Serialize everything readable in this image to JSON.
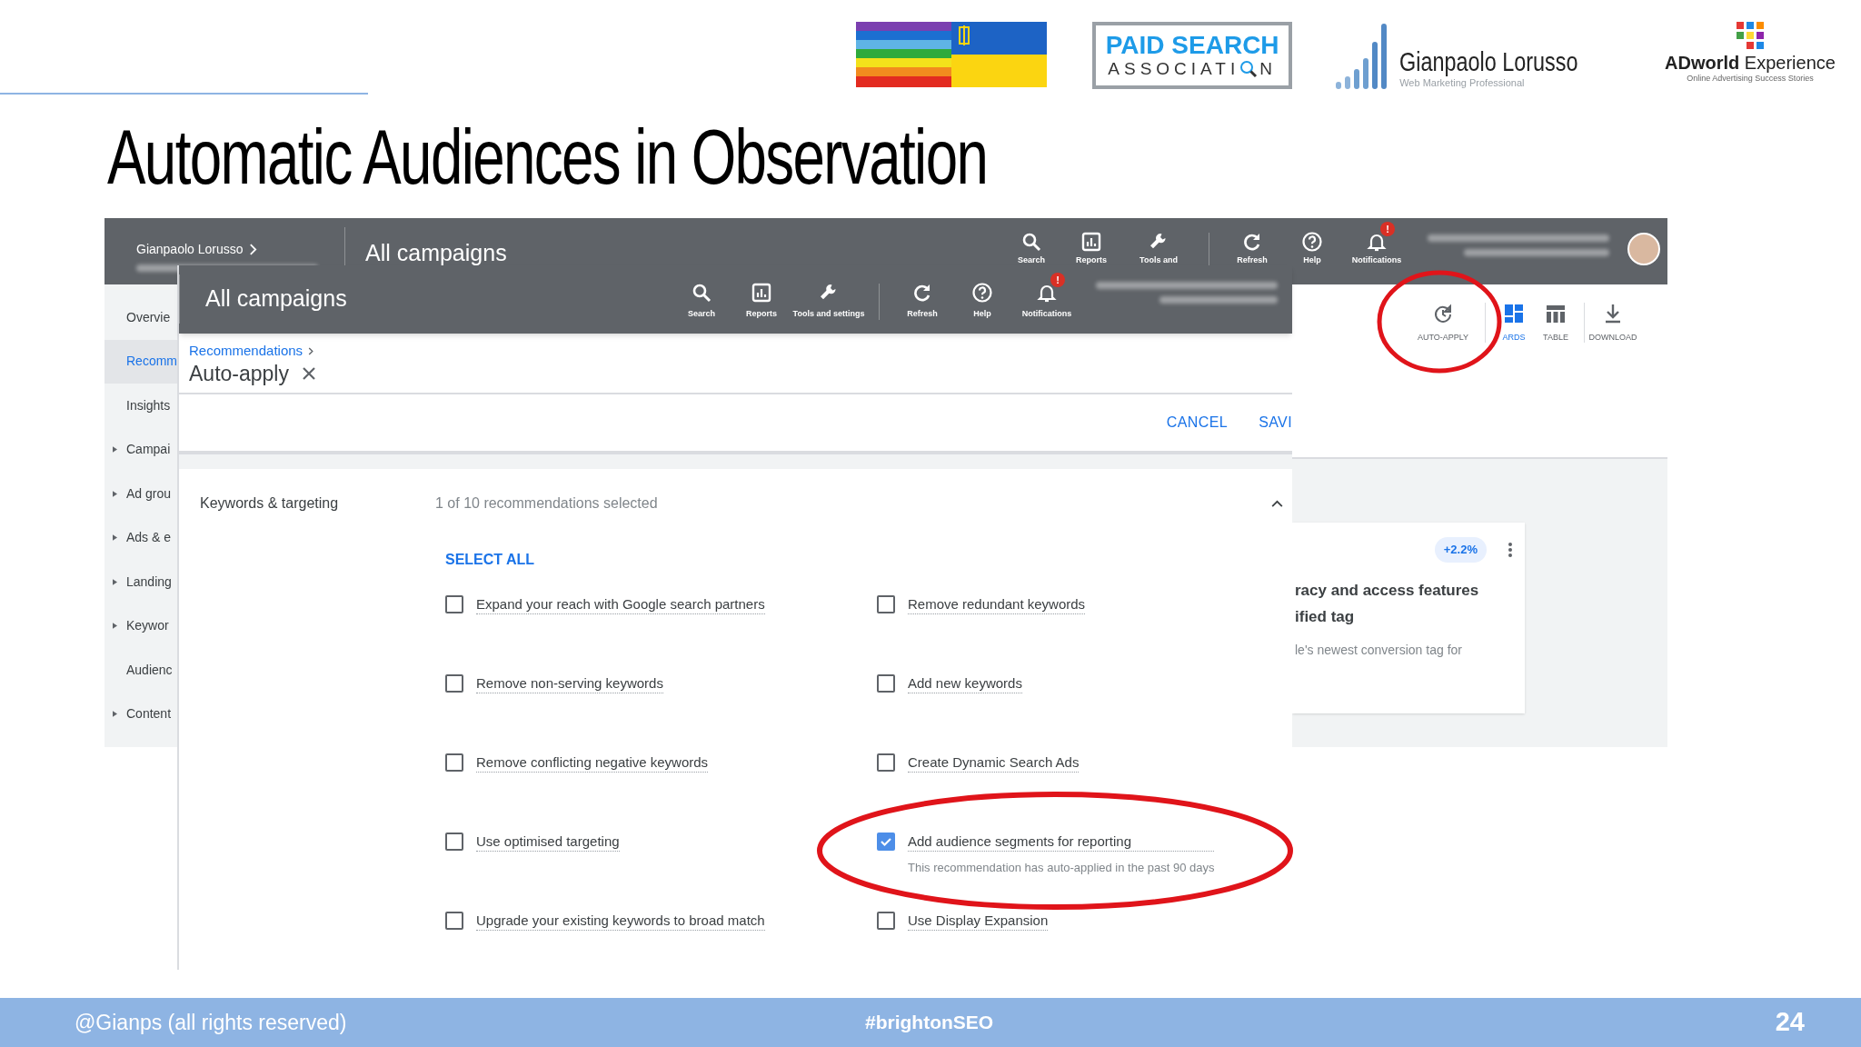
{
  "slide": {
    "title": "Automatic Audiences in Observation"
  },
  "logos": {
    "association": {
      "line_1": "PAID SEARCH",
      "line_2": "ASSOCIATI",
      "line_2_end": "N"
    },
    "author": {
      "name": "Gianpaolo Lorusso",
      "tagline": "Web Marketing Professional"
    },
    "event": {
      "name_bold": "ADworld",
      "name": "Experience",
      "tagline": "Online Advertising Success Stories"
    }
  },
  "screenshot": {
    "back": {
      "account": "Gianpaolo Lorusso",
      "title": "All campaigns",
      "toolbar": [
        {
          "kind": "search",
          "label": "Search"
        },
        {
          "kind": "reports",
          "label": "Reports"
        },
        {
          "kind": "tools",
          "label": "Tools and"
        },
        {
          "kind": "refresh",
          "label": "Refresh"
        },
        {
          "kind": "help",
          "label": "Help"
        },
        {
          "kind": "notifications",
          "label": "Notifications",
          "badge": "!"
        }
      ],
      "sidebar": [
        {
          "label": "Overvie",
          "selected": false,
          "expandable": false
        },
        {
          "label": "Recomm",
          "selected": true,
          "expandable": false
        },
        {
          "label": "Insights",
          "selected": false,
          "expandable": false
        },
        {
          "label": "Campai",
          "selected": false,
          "expandable": true
        },
        {
          "label": "Ad grou",
          "selected": false,
          "expandable": true
        },
        {
          "label": "Ads & e",
          "selected": false,
          "expandable": true
        },
        {
          "label": "Landing",
          "selected": false,
          "expandable": true
        },
        {
          "label": "Keywor",
          "selected": false,
          "expandable": true
        },
        {
          "label": "Audienc",
          "selected": false,
          "expandable": false
        },
        {
          "label": "Content",
          "selected": false,
          "expandable": true
        }
      ],
      "view_actions": [
        {
          "kind": "auto-apply",
          "label": "AUTO-APPLY",
          "selected": false
        },
        {
          "kind": "cards",
          "label": "ARDS",
          "selected": true
        },
        {
          "kind": "table",
          "label": "TABLE",
          "selected": false
        },
        {
          "kind": "download",
          "label": "DOWNLOAD",
          "selected": false
        }
      ],
      "card": {
        "badge": "+2.2%",
        "title_lines": [
          "racy and access features",
          "ified tag"
        ],
        "text": "le's newest conversion tag for"
      }
    },
    "front": {
      "title": "All campaigns",
      "toolbar": [
        {
          "kind": "search",
          "label": "Search"
        },
        {
          "kind": "reports",
          "label": "Reports"
        },
        {
          "kind": "tools",
          "label": "Tools and settings"
        },
        {
          "kind": "refresh",
          "label": "Refresh"
        },
        {
          "kind": "help",
          "label": "Help"
        },
        {
          "kind": "notifications",
          "label": "Notifications",
          "badge": "!"
        }
      ],
      "breadcrumb": "Recommendations",
      "heading": "Auto-apply",
      "actions": [
        "CANCEL",
        "SAVI"
      ],
      "section": {
        "title": "Keywords & targeting",
        "summary": "1 of 10 recommendations selected",
        "expanded": true,
        "select_all": "SELECT ALL",
        "recommendations": [
          {
            "label": "Expand your reach with Google search partners",
            "checked": false
          },
          {
            "label": "Remove redundant keywords",
            "checked": false
          },
          {
            "label": "Remove non-serving keywords",
            "checked": false
          },
          {
            "label": "Add new keywords",
            "checked": false
          },
          {
            "label": "Remove conflicting negative keywords",
            "checked": false
          },
          {
            "label": "Create Dynamic Search Ads",
            "checked": false
          },
          {
            "label": "Use optimised targeting",
            "checked": false
          },
          {
            "label": "Add audience segments for reporting",
            "checked": true,
            "note": "This recommendation has auto-applied in the past 90 days"
          },
          {
            "label": "Upgrade your existing keywords to broad match",
            "checked": false
          },
          {
            "label": "Use Display Expansion",
            "checked": false
          }
        ]
      }
    }
  },
  "footer": {
    "credit": "@Gianps (all rights reserved)",
    "hashtag": "#brightonSEO",
    "page_number": "24"
  }
}
